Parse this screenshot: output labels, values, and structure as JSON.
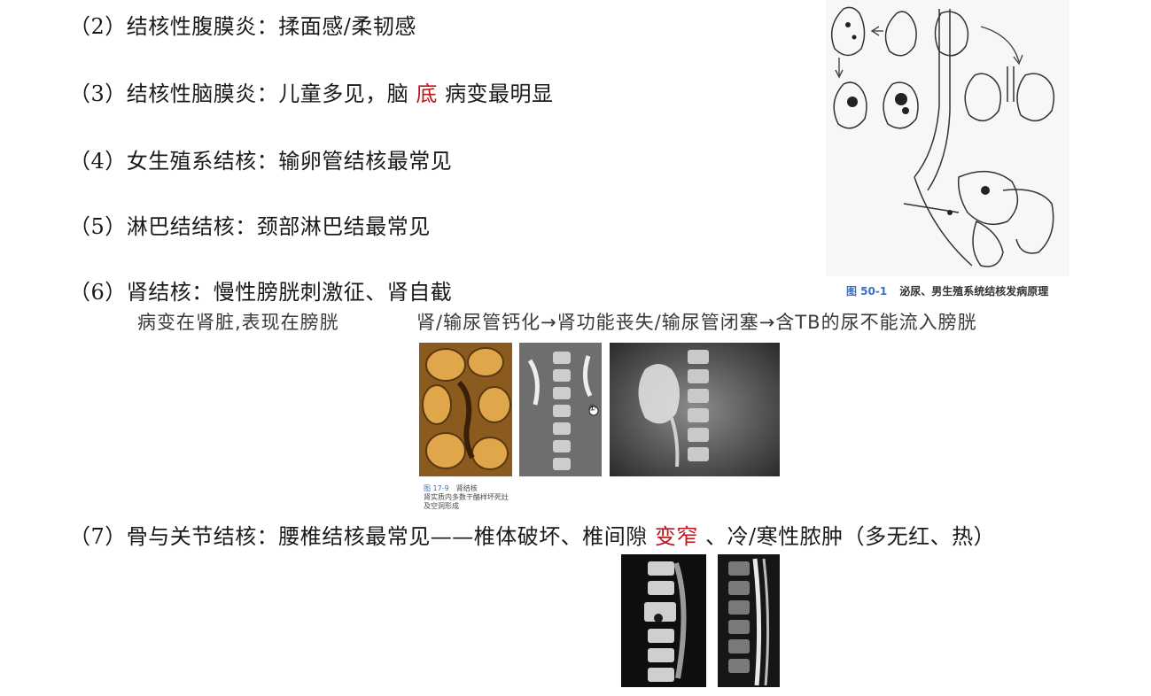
{
  "items": [
    {
      "text": "（2）结核性腹膜炎：揉面感/柔韧感"
    },
    {
      "prefix": "（3）结核性脑膜炎：儿童多见，脑",
      "highlight": "底",
      "suffix": "病变最明显"
    },
    {
      "text": "（4）女生殖系结核：输卵管结核最常见"
    },
    {
      "text": "（5）淋巴结结核：颈部淋巴结最常见"
    },
    {
      "text": "（6）肾结核：慢性膀胱刺激征、肾自截"
    },
    {
      "prefix": "（7）骨与关节结核：腰椎结核最常见——椎体破坏、椎间隙",
      "highlight": "变窄",
      "suffix": "、冷/寒性脓肿（多无红、热）"
    }
  ],
  "notes": {
    "left": "病变在肾脏,表现在膀胱",
    "right": "肾/输尿管钙化→肾功能丧失/输尿管闭塞→含TB的尿不能流入膀胱"
  },
  "figure_urogenital": {
    "caption_number": "图 50-1",
    "caption_text": "泌尿、男生殖系统结核发病原理"
  },
  "figure_kidney": {
    "caption_number": "图 17-9",
    "caption_title": "肾结核",
    "caption_line1": "肾实质内多数干酪样坏死灶",
    "caption_line2": "及空洞形成",
    "xray_marker": "①"
  },
  "colors": {
    "highlight": "#c0131a",
    "caption_number": "#3a6fc4"
  }
}
